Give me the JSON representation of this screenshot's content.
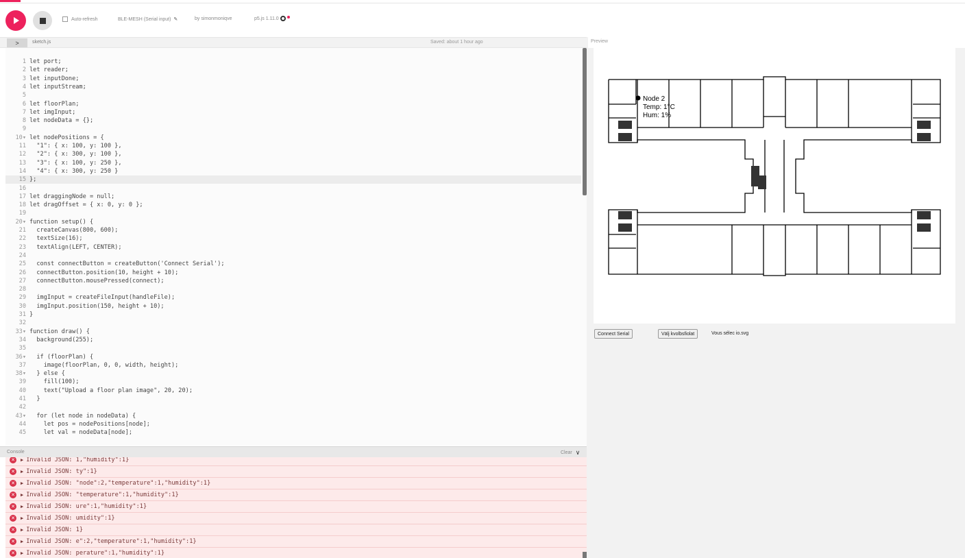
{
  "toolbar": {
    "auto_refresh_label": "Auto-refresh",
    "sketch_name": "BLE-MESH (Serial input)",
    "byline": "by simonmoniqve",
    "version": "p5.js 1.11.0"
  },
  "editor": {
    "collapse_glyph": ">",
    "file_name": "sketch.js",
    "saved_status": "Saved: about 1 hour ago",
    "lines": [
      {
        "n": "1",
        "t": "let port;"
      },
      {
        "n": "2",
        "t": "let reader;"
      },
      {
        "n": "3",
        "t": "let inputDone;"
      },
      {
        "n": "4",
        "t": "let inputStream;"
      },
      {
        "n": "5",
        "t": ""
      },
      {
        "n": "6",
        "t": "let floorPlan;"
      },
      {
        "n": "7",
        "t": "let imgInput;"
      },
      {
        "n": "8",
        "t": "let nodeData = {};"
      },
      {
        "n": "9",
        "t": ""
      },
      {
        "n": "10▾",
        "t": "let nodePositions = {"
      },
      {
        "n": "11",
        "t": "  \"1\": { x: 100, y: 100 },"
      },
      {
        "n": "12",
        "t": "  \"2\": { x: 300, y: 100 },"
      },
      {
        "n": "13",
        "t": "  \"3\": { x: 100, y: 250 },"
      },
      {
        "n": "14",
        "t": "  \"4\": { x: 300, y: 250 }"
      },
      {
        "n": "15",
        "t": "};"
      },
      {
        "n": "16",
        "t": ""
      },
      {
        "n": "17",
        "t": "let draggingNode = null;"
      },
      {
        "n": "18",
        "t": "let dragOffset = { x: 0, y: 0 };"
      },
      {
        "n": "19",
        "t": ""
      },
      {
        "n": "20▾",
        "t": "function setup() {"
      },
      {
        "n": "21",
        "t": "  createCanvas(800, 600);"
      },
      {
        "n": "22",
        "t": "  textSize(16);"
      },
      {
        "n": "23",
        "t": "  textAlign(LEFT, CENTER);"
      },
      {
        "n": "24",
        "t": ""
      },
      {
        "n": "25",
        "t": "  const connectButton = createButton('Connect Serial');"
      },
      {
        "n": "26",
        "t": "  connectButton.position(10, height + 10);"
      },
      {
        "n": "27",
        "t": "  connectButton.mousePressed(connect);"
      },
      {
        "n": "28",
        "t": ""
      },
      {
        "n": "29",
        "t": "  imgInput = createFileInput(handleFile);"
      },
      {
        "n": "30",
        "t": "  imgInput.position(150, height + 10);"
      },
      {
        "n": "31",
        "t": "}"
      },
      {
        "n": "32",
        "t": ""
      },
      {
        "n": "33▾",
        "t": "function draw() {"
      },
      {
        "n": "34",
        "t": "  background(255);"
      },
      {
        "n": "35",
        "t": ""
      },
      {
        "n": "36▾",
        "t": "  if (floorPlan) {"
      },
      {
        "n": "37",
        "t": "    image(floorPlan, 0, 0, width, height);"
      },
      {
        "n": "38▾",
        "t": "  } else {"
      },
      {
        "n": "39",
        "t": "    fill(100);"
      },
      {
        "n": "40",
        "t": "    text(\"Upload a floor plan image\", 20, 20);"
      },
      {
        "n": "41",
        "t": "  }"
      },
      {
        "n": "42",
        "t": ""
      },
      {
        "n": "43▾",
        "t": "  for (let node in nodeData) {"
      },
      {
        "n": "44",
        "t": "    let pos = nodePositions[node];"
      },
      {
        "n": "45",
        "t": "    let val = nodeData[node];"
      }
    ],
    "active_line": 14
  },
  "console": {
    "label": "Console",
    "clear_label": "Clear",
    "collapse_glyph": "∨",
    "messages": [
      "Invalid JSON: 1,\"humidity\":1}",
      "Invalid JSON: ty\":1}",
      "Invalid JSON: \"node\":2,\"temperature\":1,\"humidity\":1}",
      "Invalid JSON: \"temperature\":1,\"humidity\":1}",
      "Invalid JSON: ure\":1,\"humidity\":1}",
      "Invalid JSON: umidity\":1}",
      "Invalid JSON: 1}",
      "Invalid JSON: e\":2,\"temperature\":1,\"humidity\":1}",
      "Invalid JSON: perature\":1,\"humidity\":1}"
    ]
  },
  "preview": {
    "label": "Preview",
    "node": {
      "name": "Node 2",
      "temp": "Temp: 1°C",
      "hum": "Hum: 1%"
    },
    "connect_button": "Connect Serial",
    "file_button": "Välj kvolbsfiolat",
    "file_status": "Vous sélec io.svg"
  }
}
